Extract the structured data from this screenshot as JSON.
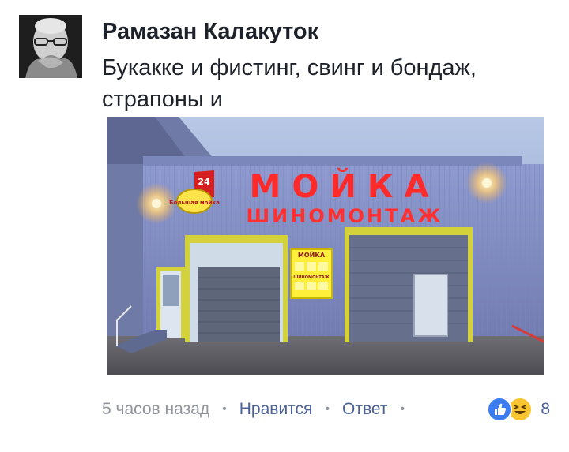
{
  "comment": {
    "author": "Рамазан Калакуток",
    "text": "Букакке и фистинг, свинг и бондаж, страпоны и",
    "photo": {
      "sign_main": "МОЙКА",
      "sign_sub": "ШИНОМОНТАЖ",
      "badge_number": "24",
      "badge_text": "Большая мойка",
      "panel_title": "МОЙКА",
      "panel_sub": "ШИНОМОНТАЖ"
    },
    "timestamp": "5 часов назад",
    "like_label": "Нравится",
    "reply_label": "Ответ",
    "reaction_count": "8",
    "reactions": [
      "like-icon",
      "haha-icon"
    ]
  },
  "colors": {
    "text": "#1d2129",
    "meta": "#90949c",
    "link": "#4b6197",
    "like": "#3b7cf2",
    "haha": "#f7c531",
    "sign_red": "#ff2a2a"
  }
}
